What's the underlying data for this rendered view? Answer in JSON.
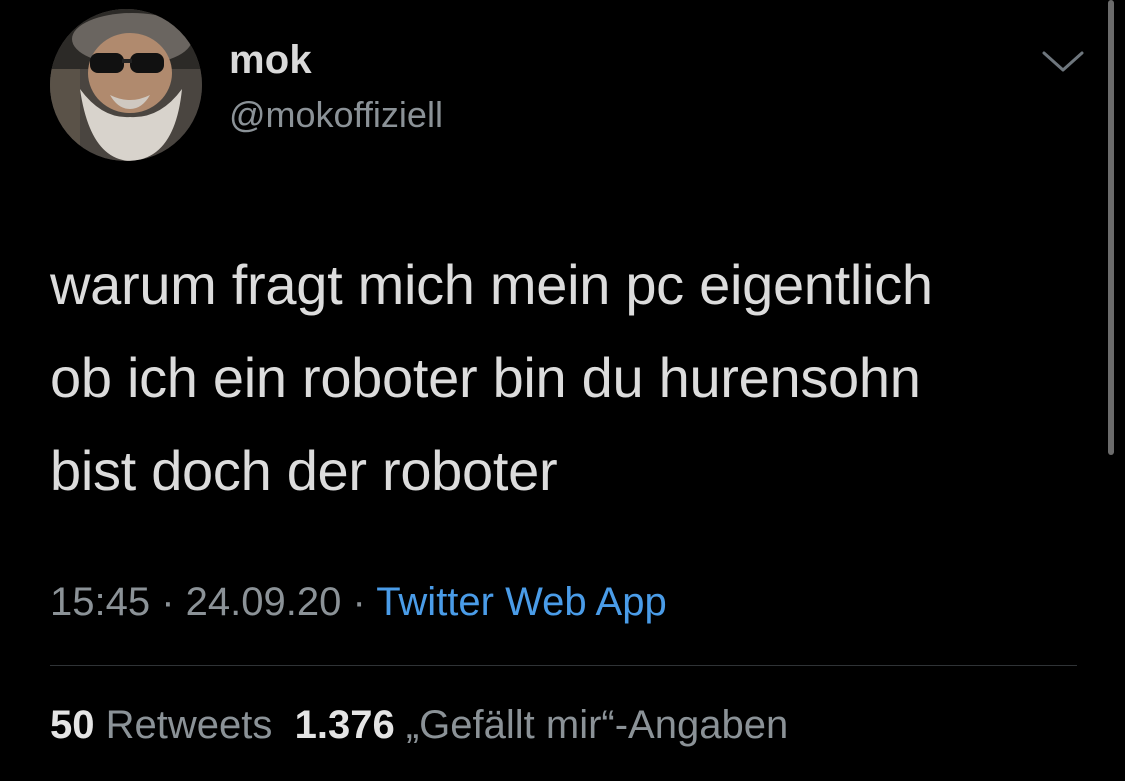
{
  "user": {
    "name": "mok",
    "handle": "@mokoffiziell"
  },
  "tweet": {
    "lines": [
      "warum fragt mich mein pc eigentlich",
      "ob ich ein roboter bin du hurensohn",
      "bist doch der roboter"
    ],
    "time": "15:45",
    "separator": " · ",
    "date": "24.09.20",
    "source": "Twitter Web App"
  },
  "stats": {
    "retweets_count": "50",
    "retweets_label": "Retweets",
    "likes_count": "1.376",
    "likes_label": "„Gefällt mir“-Angaben"
  },
  "icons": {
    "avatar": "user-avatar-image",
    "more": "chevron-down-icon"
  },
  "colors": {
    "background": "#000000",
    "text": "#d9d9d9",
    "secondary": "#8b9297",
    "link": "#4a9ce8"
  }
}
